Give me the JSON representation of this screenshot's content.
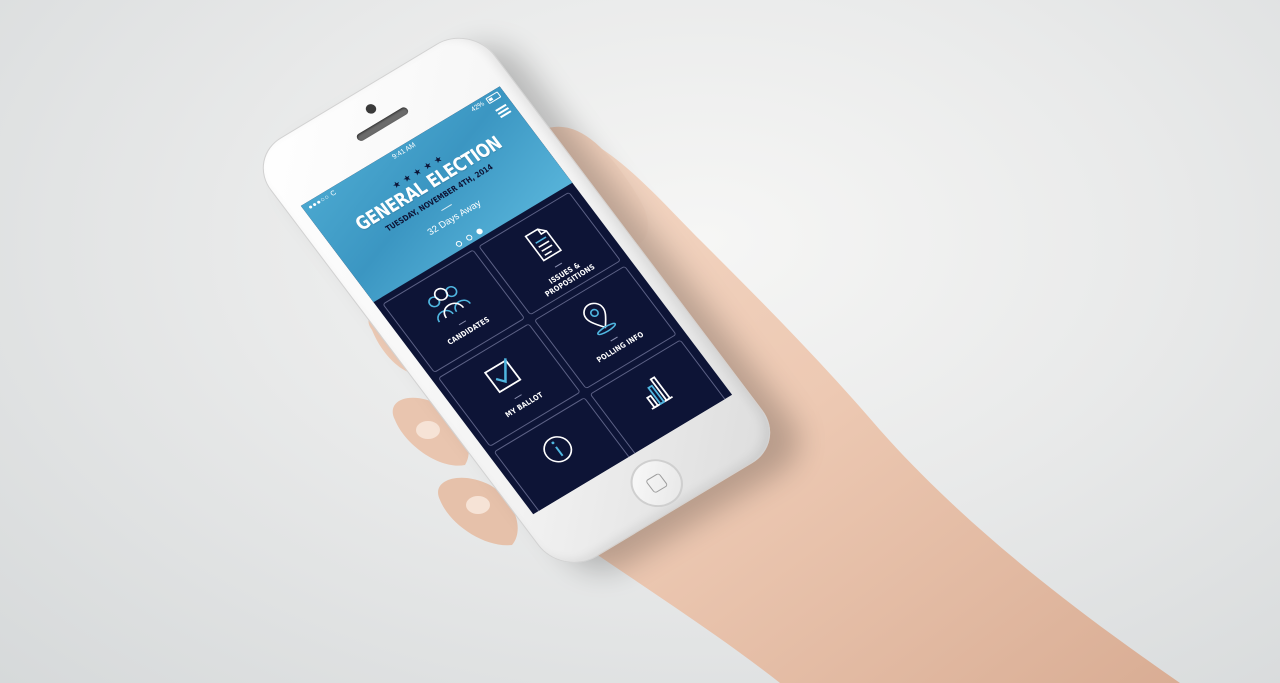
{
  "status_bar": {
    "carrier": "●●●○○ C",
    "time": "9:41 AM",
    "battery": "42%"
  },
  "header": {
    "stars": "★★★★★",
    "title": "GENERAL ELECTION",
    "subtitle": "TUESDAY, NOVEMBER 4TH, 2014",
    "countdown": "32 Days Away",
    "page_count": 3,
    "active_page": 3
  },
  "tiles": [
    {
      "label": "CANDIDATES",
      "icon": "people-icon"
    },
    {
      "label": "ISSUES & PROPOSITIONS",
      "icon": "document-icon"
    },
    {
      "label": "MY BALLOT",
      "icon": "checkbox-icon"
    },
    {
      "label": "POLLING INFO",
      "icon": "location-pin-icon"
    },
    {
      "label": "",
      "icon": "info-icon"
    },
    {
      "label": "",
      "icon": "bar-chart-icon"
    }
  ],
  "colors": {
    "header_blue": "#4aa7cf",
    "tile_navy": "#0d1436",
    "accent_cyan": "#4fb6e0"
  }
}
